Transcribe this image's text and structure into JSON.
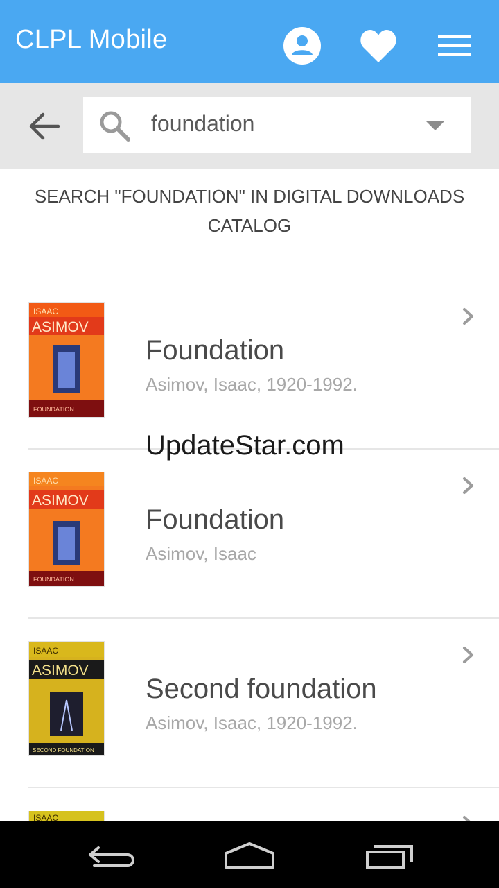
{
  "app": {
    "title": "CLPL Mobile",
    "header_color": "#4aa8f2"
  },
  "header": {
    "icons": [
      "account-icon",
      "favorites-heart-icon",
      "menu-icon"
    ]
  },
  "search": {
    "query": "foundation"
  },
  "catalog_link": "SEARCH \"FOUNDATION\" IN DIGITAL DOWNLOADS CATALOG",
  "results": [
    {
      "title": "Foundation",
      "author": "Asimov, Isaac, 1920-1992.",
      "cover": {
        "top": "ISAAC",
        "name": "ASIMOV",
        "bottom": "FOUNDATION",
        "color": "#f47a20"
      }
    },
    {
      "title": "Foundation",
      "author": "Asimov, Isaac",
      "cover": {
        "top": "ISAAC",
        "name": "ASIMOV",
        "bottom": "FOUNDATION",
        "color": "#f47a20"
      }
    },
    {
      "title": "Second foundation",
      "author": "Asimov, Isaac, 1920-1992.",
      "cover": {
        "top": "ISAAC",
        "name": "ASIMOV",
        "bottom": "SECOND FOUNDATION",
        "color": "#d6b21e"
      }
    },
    {
      "title": "",
      "author": "",
      "cover": {
        "top": "ISAAC",
        "name": "",
        "bottom": "",
        "color": "#d6c21e"
      }
    }
  ],
  "watermark": "UpdateStar.com",
  "system_nav": [
    "back-nav-icon",
    "home-nav-icon",
    "recents-nav-icon"
  ]
}
